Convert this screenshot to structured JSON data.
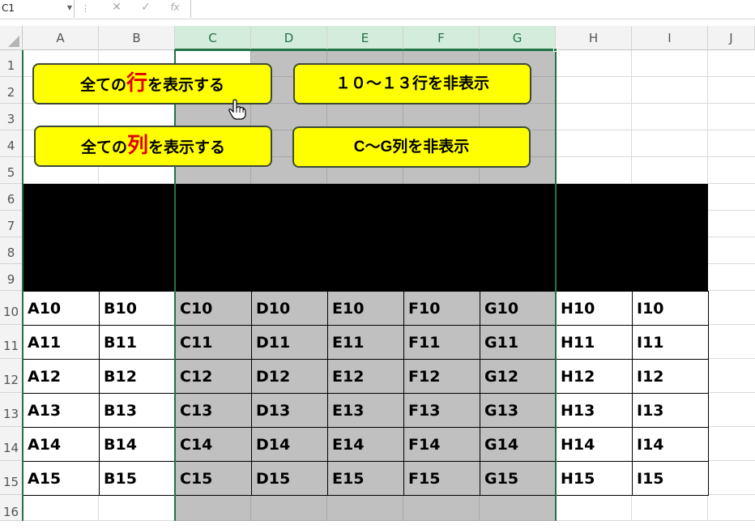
{
  "formula_bar": {
    "name_box": "C1",
    "cancel_icon": "✕",
    "enter_icon": "✓",
    "fx_label": "fx",
    "formula": ""
  },
  "columns": [
    "A",
    "B",
    "C",
    "D",
    "E",
    "F",
    "G",
    "H",
    "I",
    "J"
  ],
  "selected_columns": [
    "C",
    "D",
    "E",
    "F",
    "G"
  ],
  "rows": [
    "1",
    "2",
    "3",
    "4",
    "5",
    "6",
    "7",
    "8",
    "9",
    "10",
    "11",
    "12",
    "13",
    "14",
    "15",
    "16"
  ],
  "buttons": {
    "show_all_rows": {
      "pre": "全ての",
      "hl": "行",
      "post": "を表示する"
    },
    "hide_rows_10_13": {
      "label": "１０～１３行を非表示"
    },
    "show_all_cols": {
      "pre": "全ての",
      "hl": "列",
      "post": "を表示する"
    },
    "hide_cols_c_g": {
      "label": "C～G列を非表示"
    }
  },
  "table": {
    "rows": [
      [
        "A10",
        "B10",
        "C10",
        "D10",
        "E10",
        "F10",
        "G10",
        "H10",
        "I10"
      ],
      [
        "A11",
        "B11",
        "C11",
        "D11",
        "E11",
        "F11",
        "G11",
        "H11",
        "I11"
      ],
      [
        "A12",
        "B12",
        "C12",
        "D12",
        "E12",
        "F12",
        "G12",
        "H12",
        "I12"
      ],
      [
        "A13",
        "B13",
        "C13",
        "D13",
        "E13",
        "F13",
        "G13",
        "H13",
        "I13"
      ],
      [
        "A14",
        "B14",
        "C14",
        "D14",
        "E14",
        "F14",
        "G14",
        "H14",
        "I14"
      ],
      [
        "A15",
        "B15",
        "C15",
        "D15",
        "E15",
        "F15",
        "G15",
        "H15",
        "I15"
      ]
    ]
  },
  "colors": {
    "selection": "#217346",
    "selected_fill": "#c0c0c0",
    "button_fill": "#ffff00",
    "band": "#000000"
  },
  "icons": {
    "cursor": "hand-pointer-icon"
  }
}
